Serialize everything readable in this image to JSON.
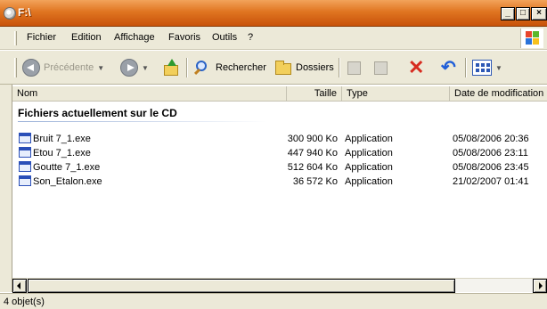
{
  "window": {
    "title": "F:\\"
  },
  "title_buttons": {
    "minimize": "_",
    "maximize": "□",
    "close": "×"
  },
  "menu": [
    {
      "label": "Fichier"
    },
    {
      "label": "Edition"
    },
    {
      "label": "Affichage"
    },
    {
      "label": "Favoris"
    },
    {
      "label": "Outils"
    },
    {
      "label": "?"
    }
  ],
  "toolbar": {
    "back_label": "Précédente",
    "search_label": "Rechercher",
    "folders_label": "Dossiers",
    "delete_glyph": "✕",
    "undo_glyph": "↶"
  },
  "columns": {
    "name": "Nom",
    "size": "Taille",
    "type": "Type",
    "date": "Date de modification"
  },
  "group": {
    "title": "Fichiers actuellement sur le CD"
  },
  "files": [
    {
      "name": "Bruit 7_1.exe",
      "size": "300 900 Ko",
      "type": "Application",
      "date": "05/08/2006 20:36"
    },
    {
      "name": "Etou 7_1.exe",
      "size": "447 940 Ko",
      "type": "Application",
      "date": "05/08/2006 23:11"
    },
    {
      "name": "Goutte 7_1.exe",
      "size": "512 604 Ko",
      "type": "Application",
      "date": "05/08/2006 23:45"
    },
    {
      "name": "Son_Etalon.exe",
      "size": "36 572 Ko",
      "type": "Application",
      "date": "21/02/2007 01:41"
    }
  ],
  "status": {
    "text": "4 objet(s)"
  },
  "colors": {
    "titlebar": "#e07521",
    "chrome": "#ece9d8",
    "delete": "#d72b1f",
    "undo": "#1f5ed8"
  },
  "icons": {
    "title": "cd-drive-icon",
    "back": "back-arrow-icon",
    "forward": "forward-arrow-icon",
    "up": "folder-up-icon",
    "search": "search-icon",
    "folders": "folders-icon",
    "move": "move-to-icon",
    "copy": "copy-to-icon",
    "delete": "delete-icon",
    "undo": "undo-icon",
    "views": "views-icon",
    "file": "executable-file-icon"
  }
}
